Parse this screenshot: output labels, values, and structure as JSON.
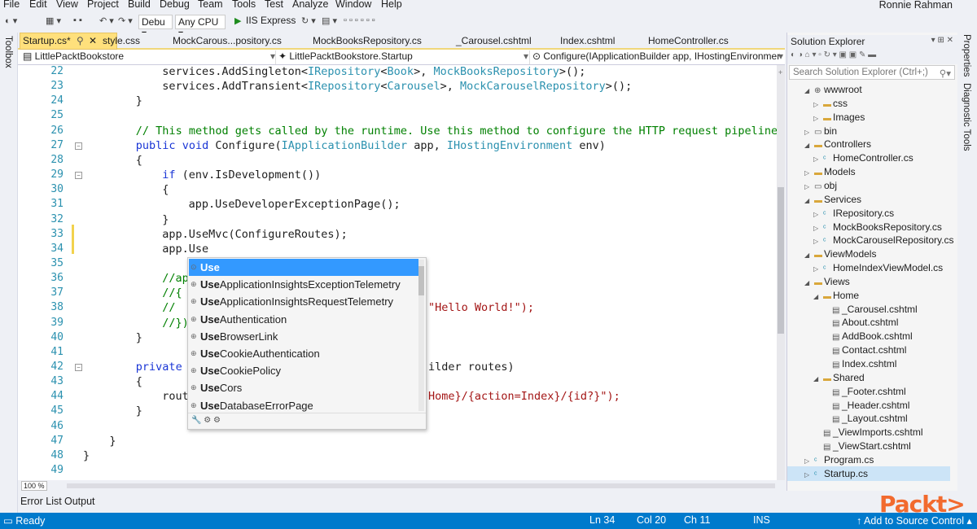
{
  "menu": [
    "File",
    "Edit",
    "View",
    "Project",
    "Build",
    "Debug",
    "Team",
    "Tools",
    "Test",
    "Analyze",
    "Window",
    "Help"
  ],
  "user": "Ronnie Rahman",
  "toolbar": {
    "config": "Debu",
    "platform": "Any CPU",
    "run": "IIS Express"
  },
  "side_left": {
    "toolbox": "Toolbox"
  },
  "side_right": {
    "properties": "Properties",
    "diagnostic": "Diagnostic Tools"
  },
  "tabs": [
    "Startup.cs*",
    "style.css",
    "MockCarous...pository.cs",
    "MockBooksRepository.cs",
    "_Carousel.cshtml",
    "Index.cshtml",
    "HomeController.cs"
  ],
  "navbar": {
    "project": "LittlePacktBookstore",
    "type": "LittlePacktBookstore.Startup",
    "member": "Configure(IApplicationBuilder app, IHostingEnvironmer"
  },
  "line_numbers": [
    "22",
    "23",
    "24",
    "25",
    "26",
    "27",
    "28",
    "29",
    "30",
    "31",
    "32",
    "33",
    "34",
    "35",
    "36",
    "37",
    "38",
    "39",
    "40",
    "41",
    "42",
    "43",
    "44",
    "45",
    "46",
    "47",
    "48",
    "49"
  ],
  "code": {
    "l22": "services.AddSingleton<IRepository<Book>, MockBooksRepository>();",
    "l23": "services.AddTransient<IRepository<Carousel>, MockCarouselRepository>();",
    "l24": "}",
    "l26": "// This method gets called by the runtime. Use this method to configure the HTTP request pipeline",
    "l27": "public void Configure(IApplicationBuilder app, IHostingEnvironment env)",
    "l28": "{",
    "l29": "if (env.IsDevelopment())",
    "l30": "{",
    "l31": "app.UseDeveloperExceptionPage();",
    "l32": "}",
    "l33": "app.UseMvc(ConfigureRoutes);",
    "l34": "app.Use",
    "l36": "//ap",
    "l37": "//{",
    "l38": "//",
    "l38b": "\"Hello World!\");",
    "l39": "//})",
    "l40": "}",
    "l42a": "private",
    "l42b": "ilder routes)",
    "l43": "{",
    "l44a": "rout",
    "l44b": "Home}/{action=Index}/{id?}\");",
    "l45": "}",
    "l47": "}",
    "l48": "}"
  },
  "autocomplete": {
    "items": [
      {
        "bold": "Use",
        "rest": ""
      },
      {
        "bold": "Use",
        "rest": "ApplicationInsightsExceptionTelemetry"
      },
      {
        "bold": "Use",
        "rest": "ApplicationInsightsRequestTelemetry"
      },
      {
        "bold": "Use",
        "rest": "Authentication"
      },
      {
        "bold": "Use",
        "rest": "BrowserLink"
      },
      {
        "bold": "Use",
        "rest": "CookieAuthentication"
      },
      {
        "bold": "Use",
        "rest": "CookiePolicy"
      },
      {
        "bold": "Use",
        "rest": "Cors"
      },
      {
        "bold": "Use",
        "rest": "DatabaseErrorPage"
      }
    ]
  },
  "zoom": "100 %",
  "bottom_tabs": [
    "Error List",
    "Output"
  ],
  "status": {
    "ready": "Ready",
    "ln": "Ln 34",
    "col": "Col 20",
    "ch": "Ch 11",
    "ins": "INS",
    "source": "Add to Source Control"
  },
  "solution_explorer": {
    "title": "Solution Explorer",
    "search_placeholder": "Search Solution Explorer (Ctrl+;)",
    "tree": [
      "wwwroot",
      "css",
      "Images",
      "bin",
      "Controllers",
      "HomeController.cs",
      "Models",
      "obj",
      "Services",
      "IRepository.cs",
      "MockBooksRepository.cs",
      "MockCarouselRepository.cs",
      "ViewModels",
      "HomeIndexViewModel.cs",
      "Views",
      "Home",
      "_Carousel.cshtml",
      "About.cshtml",
      "AddBook.cshtml",
      "Contact.cshtml",
      "Index.cshtml",
      "Shared",
      "_Footer.cshtml",
      "_Header.cshtml",
      "_Layout.cshtml",
      "_ViewImports.cshtml",
      "_ViewStart.cshtml",
      "Program.cs",
      "Startup.cs"
    ]
  },
  "brand": "Packt>",
  "colors": {
    "accent": "#007acc",
    "tab_active": "#ffe07c",
    "selection": "#3399ff",
    "keyword": "#1a36d6",
    "type": "#2b91af",
    "comment": "#008000",
    "string": "#a31515"
  }
}
